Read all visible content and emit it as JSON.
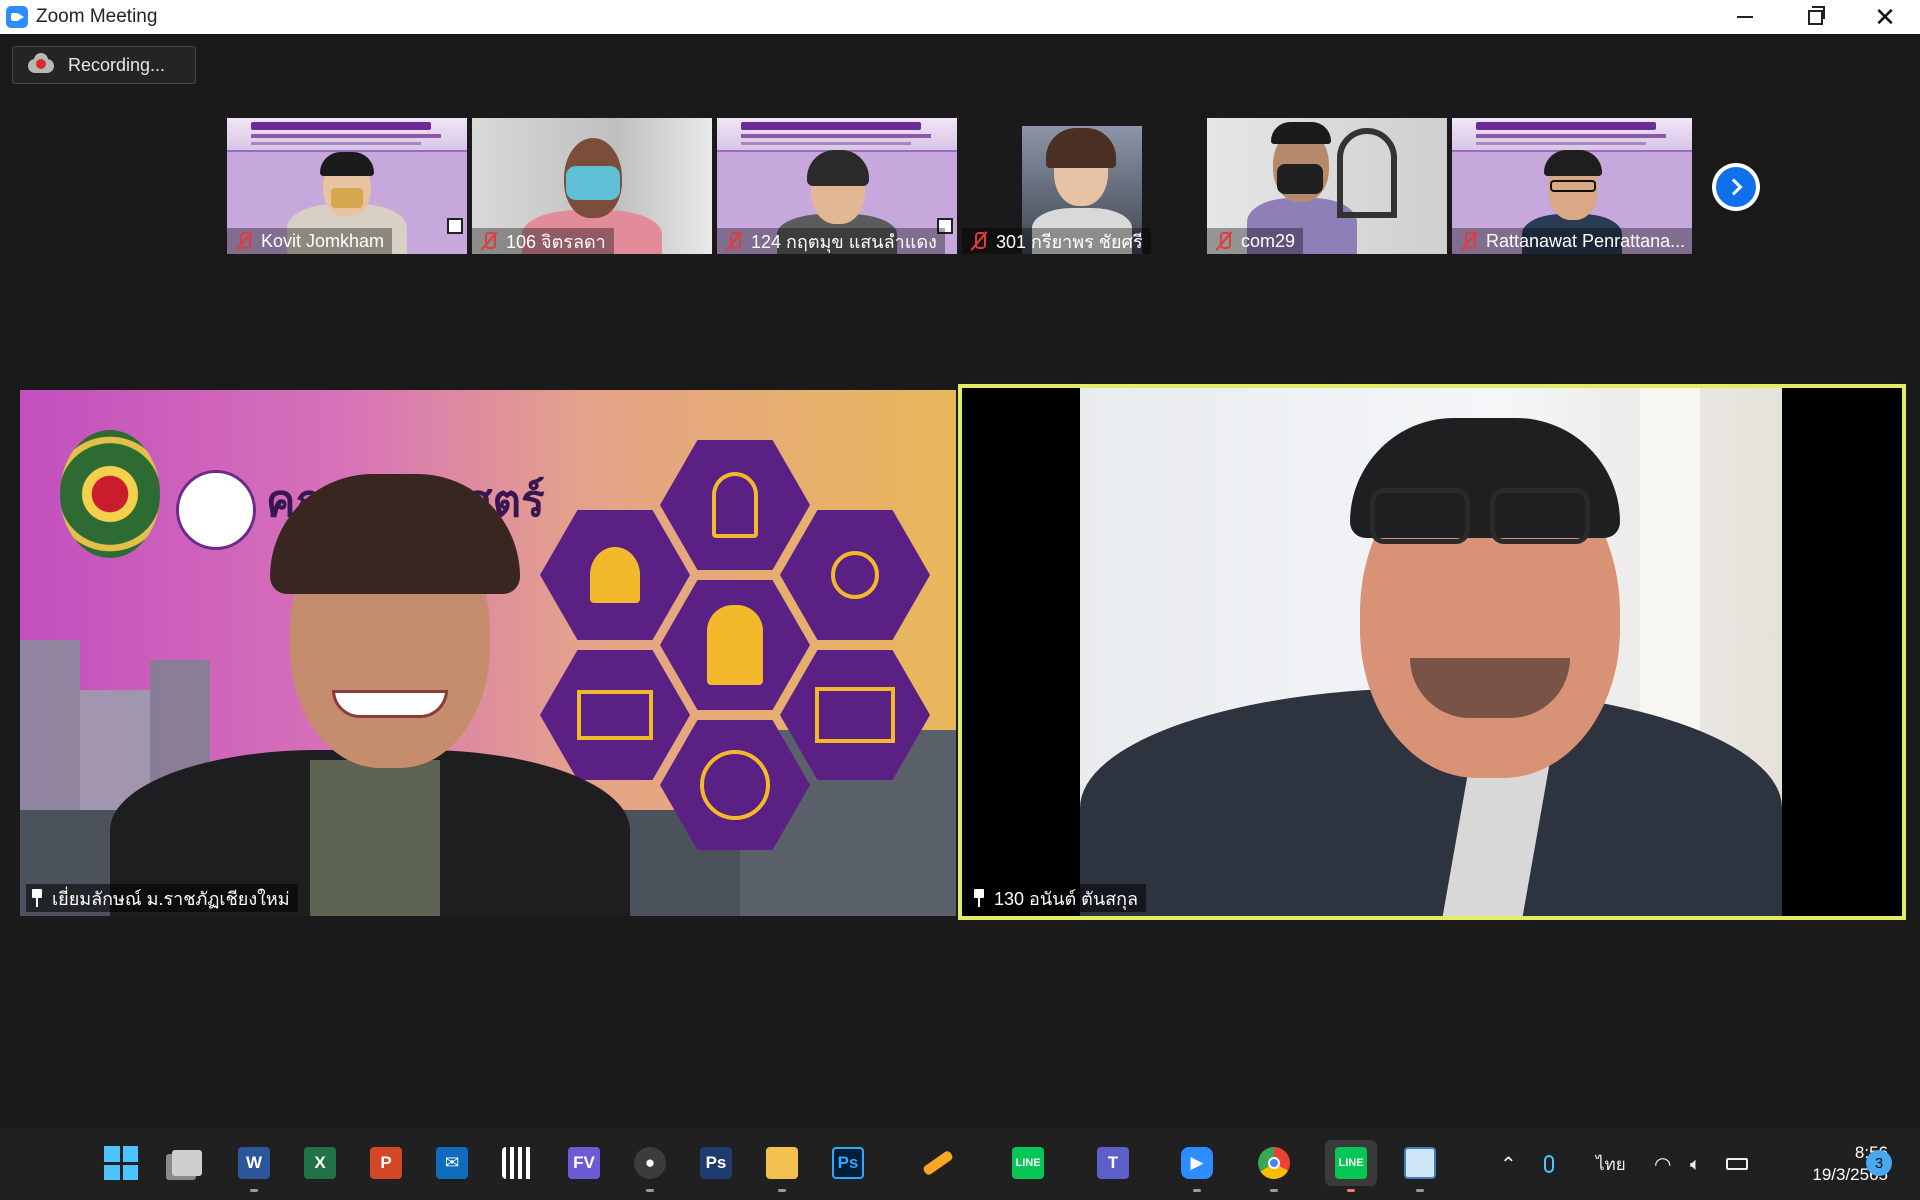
{
  "window": {
    "title": "Zoom Meeting",
    "controls": [
      "minimize-icon",
      "restore-icon",
      "close-icon"
    ]
  },
  "recording": {
    "label": "Recording..."
  },
  "gallery": {
    "participants": [
      {
        "name": "Kovit Jomkham",
        "muted": true
      },
      {
        "name": "106 จิตรลดา",
        "muted": true
      },
      {
        "name": "124 กฤตมุข แสนลำแดง",
        "muted": true
      },
      {
        "name": "301 กรียาพร ชัยศรี",
        "muted": true
      },
      {
        "name": "com29",
        "muted": true
      },
      {
        "name": "Rattanawat Penrattana...",
        "muted": true
      }
    ],
    "next_icon": "chevron-right-icon"
  },
  "main": {
    "left": {
      "name": "เยี่ยมลักษณ์ ม.ราชภัฏเชียงใหม่",
      "pinned": true,
      "background_text": "คณะครุศาสตร์"
    },
    "right": {
      "name": "130 อนันต์ ตันสกุล",
      "pinned": true,
      "active_speaker_color": "#e4ec63"
    }
  },
  "taskbar": {
    "apps": [
      "windows-start",
      "task-view",
      "word",
      "excel",
      "powerpoint",
      "mail",
      "qr-app",
      "fv-app",
      "obs",
      "photoshop-elements",
      "file-explorer",
      "photoshop",
      "pen-tool",
      "line",
      "teams",
      "zoom",
      "chrome",
      "line-active",
      "whiteboard"
    ],
    "tray": {
      "language": "ไทย",
      "time": "8:56",
      "date": "19/3/2565",
      "notifications": "3"
    }
  }
}
